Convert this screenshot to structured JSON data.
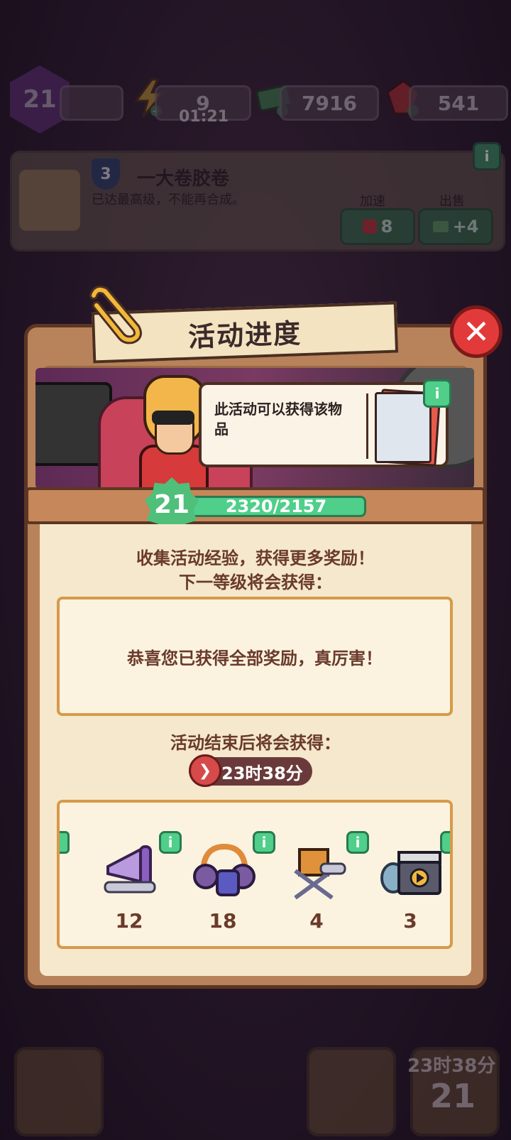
{
  "hud": {
    "player_level": "21",
    "energy": "9",
    "energy_timer": "01:21",
    "cash": "7916",
    "gems": "541"
  },
  "item": {
    "tier": "3",
    "name": "一大卷胶卷",
    "desc": "已达最高级，不能再合成。",
    "speedup_label": "加速",
    "sell_label": "出售",
    "speedup_cost": "8",
    "sell_value": "+4"
  },
  "modal": {
    "title": "活动进度",
    "tooltip_text": "此活动可以获得该物品",
    "level": "21",
    "xp_text": "2320/2157",
    "collect_line1": "收集活动经验，获得更多奖励！",
    "collect_line2": "下一等级将会获得：",
    "all_rewards_msg": "恭喜您已获得全部奖励，真厉害！",
    "after_event_label": "活动结束后将会获得：",
    "timer": "23时38分",
    "rewards": [
      {
        "name": "megaphone",
        "count": "12"
      },
      {
        "name": "headphones",
        "count": "18"
      },
      {
        "name": "director-chair",
        "count": "4"
      },
      {
        "name": "film-clapper",
        "count": "3"
      }
    ]
  },
  "bottom": {
    "event_timer": "23时38分",
    "event_level": "21"
  },
  "colors": {
    "accent_green": "#4fcf8a",
    "close_red": "#e23a3a",
    "panel_cream": "#f5e8cc",
    "text_brown": "#6a3a2a"
  }
}
